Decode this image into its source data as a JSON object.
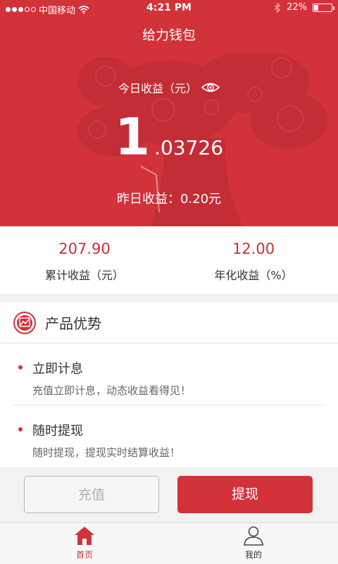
{
  "status_bar": {
    "carrier": "中国移动",
    "time": "4:21 PM",
    "battery": "22%",
    "signal_bars_filled": 3,
    "signal_bars_total": 5
  },
  "nav": {
    "title": "给力钱包"
  },
  "hero": {
    "label": "今日收益（元）",
    "amount_int": "1",
    "amount_dec": ".03726",
    "yesterday": "昨日收益：0.20元"
  },
  "stats": [
    {
      "value": "207.90",
      "label": "累计收益（元）"
    },
    {
      "value": "12.00",
      "label": "年化收益（%）"
    }
  ],
  "advantages": {
    "title": "产品优势",
    "items": [
      {
        "title": "立即计息",
        "desc": "充值立即计息，动态收益看得见！"
      },
      {
        "title": "随时提现",
        "desc": "随时提现，提现实时结算收益！"
      }
    ]
  },
  "buttons": {
    "recharge": "充值",
    "withdraw": "提现"
  },
  "tabs": [
    {
      "label": "首页",
      "icon": "home-icon",
      "active": true
    },
    {
      "label": "我的",
      "icon": "user-icon",
      "active": false
    }
  ],
  "colors": {
    "brand": "#d2323a",
    "accent_text": "#c8303a",
    "disabled": "#b0b0b0"
  }
}
